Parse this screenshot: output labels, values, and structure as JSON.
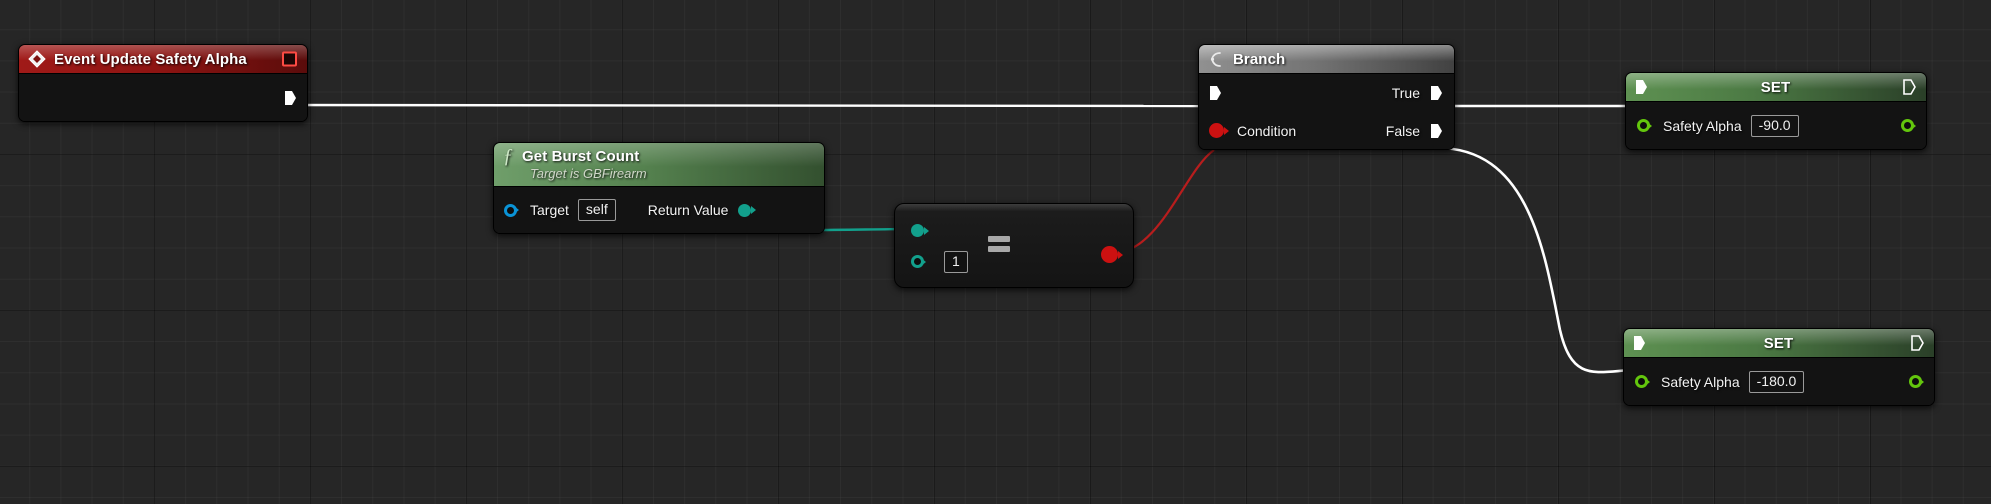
{
  "app": {
    "title": "Blueprint Event Graph",
    "background_color": "#262626",
    "grid_color": "#000000"
  },
  "colors": {
    "exec_white": "#ffffff",
    "bool_red": "#cc1111",
    "int_teal": "#12a08c",
    "float_green": "#63c60d",
    "object_blue": "#0a93d6",
    "event_header_red": "#8e1412",
    "function_header_green": "#55824f",
    "branch_header_gray": "#6e6e6e",
    "set_header_green": "#4c7a44"
  },
  "nodes": {
    "event": {
      "id": "event-update-safety-alpha",
      "title": "Event Update Safety Alpha",
      "icon": "event-diamond-icon",
      "delegate_pin_name": "delegate-output-pin",
      "output_exec_label": ""
    },
    "get_burst_count": {
      "id": "get-burst-count",
      "title": "Get Burst Count",
      "subtitle": "Target is GBFirearm",
      "icon": "function-f-icon",
      "inputs": [
        {
          "label": "Target",
          "value": "self",
          "pin_type": "object",
          "pin_style": "hollow"
        }
      ],
      "outputs": [
        {
          "label": "Return Value",
          "pin_type": "int",
          "pin_style": "filled"
        }
      ]
    },
    "equals": {
      "id": "integer-equals",
      "operator": "==",
      "inputs": [
        {
          "label": "",
          "value": "",
          "pin_type": "int",
          "pin_style": "filled"
        },
        {
          "label": "",
          "value": "1",
          "pin_type": "int",
          "pin_style": "hollow"
        }
      ],
      "outputs": [
        {
          "label": "",
          "pin_type": "bool",
          "pin_style": "filled"
        }
      ]
    },
    "branch": {
      "id": "branch",
      "title": "Branch",
      "icon": "branch-icon",
      "inputs": [
        {
          "label": "",
          "pin_type": "exec"
        },
        {
          "label": "Condition",
          "pin_type": "bool",
          "pin_style": "filled"
        }
      ],
      "outputs": [
        {
          "label": "True",
          "pin_type": "exec"
        },
        {
          "label": "False",
          "pin_type": "exec"
        }
      ]
    },
    "set_true": {
      "id": "set-safety-alpha-true",
      "title": "SET",
      "property_label": "Safety Alpha",
      "value": "-90.0",
      "pin_type": "float"
    },
    "set_false": {
      "id": "set-safety-alpha-false",
      "title": "SET",
      "property_label": "Safety Alpha",
      "value": "-180.0",
      "pin_type": "float"
    }
  },
  "chart_data": {
    "type": "diagram",
    "title": "Event Update Safety Alpha graph",
    "connections": [
      {
        "from": "event.exec_out",
        "to": "branch.exec_in",
        "wire": "exec",
        "color": "#ffffff"
      },
      {
        "from": "get_burst_count.return_value",
        "to": "equals.input_a",
        "wire": "data",
        "color": "#12a08c"
      },
      {
        "from": "equals.result",
        "to": "branch.condition",
        "wire": "data",
        "color": "#cc1111"
      },
      {
        "from": "branch.true",
        "to": "set_true.exec_in",
        "wire": "exec",
        "color": "#ffffff"
      },
      {
        "from": "branch.false",
        "to": "set_false.exec_in",
        "wire": "exec",
        "color": "#ffffff"
      }
    ]
  }
}
